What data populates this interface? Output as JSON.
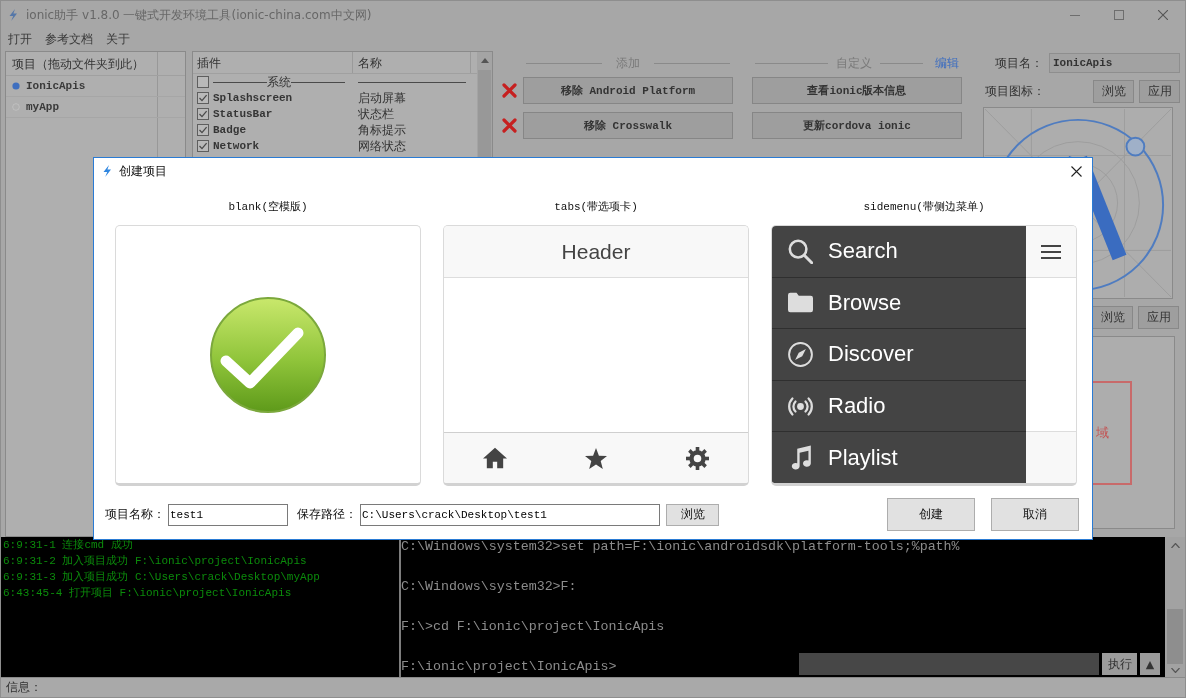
{
  "window": {
    "title": "ionic助手 v1.8.0 一键式开发环境工具(ionic-china.com中文网)"
  },
  "menu": [
    "打开",
    "参考文档",
    "关于"
  ],
  "projects": {
    "header": "项目（拖动文件夹到此）",
    "items": [
      {
        "label": "IonicApis",
        "selected": true
      },
      {
        "label": "myApp",
        "selected": false
      }
    ]
  },
  "plugins": {
    "columns": [
      "插件",
      "名称"
    ],
    "rows": [
      {
        "kind": "group",
        "label": "系统",
        "checked": false
      },
      {
        "kind": "plugin",
        "label": "Splashscreen",
        "name": "启动屏幕",
        "checked": true
      },
      {
        "kind": "plugin",
        "label": "StatusBar",
        "name": "状态栏",
        "checked": true
      },
      {
        "kind": "plugin",
        "label": "Badge",
        "name": "角标提示",
        "checked": true
      },
      {
        "kind": "plugin",
        "label": "Network",
        "name": "网络状态",
        "checked": true
      }
    ]
  },
  "actions": {
    "add_header": "添加",
    "custom_header": "自定义",
    "edit_link": "编辑",
    "remove_buttons": [
      "移除 Android Platform",
      "移除 Crosswalk"
    ],
    "custom_buttons": [
      "查看ionic版本信息",
      "更新cordova ionic"
    ]
  },
  "project_info": {
    "name_label": "项目名：",
    "name_value": "IonicApis",
    "icon_label": "项目图标：",
    "icon_buttons": [
      "浏览",
      "应用"
    ],
    "splash_buttons": [
      "浏览",
      "应用"
    ],
    "splash_area_text": "域"
  },
  "log": [
    "6:9:31-1 连接cmd 成功",
    "6:9:31-2 加入项目成功 F:\\ionic\\project\\IonicApis",
    "6:9:31-3 加入项目成功 C:\\Users\\crack\\Desktop\\myApp",
    "6:43:45-4 打开项目 F:\\ionic\\project\\IonicApis"
  ],
  "console": {
    "lines": [
      "C:\\Windows\\system32>set path=F:\\ionic\\androidsdk\\platform-tools;%path%",
      "C:\\Windows\\system32>F:",
      "F:\\>cd F:\\ionic\\project\\IonicApis",
      "F:\\ionic\\project\\IonicApis>"
    ],
    "run_button": "执行",
    "history_button": "▲"
  },
  "status_bar": {
    "label": "信息："
  },
  "dialog": {
    "title": "创建项目",
    "templates": [
      {
        "kind": "blank",
        "label": "blank(空模版)"
      },
      {
        "kind": "tabs",
        "label": "tabs(带选项卡)",
        "header": "Header"
      },
      {
        "kind": "sidemenu",
        "label": "sidemenu(带侧边菜单)",
        "menu_items": [
          "Search",
          "Browse",
          "Discover",
          "Radio",
          "Playlist"
        ]
      }
    ],
    "name_label": "项目名称：",
    "name_value": "test1",
    "path_label": "保存路径：",
    "path_value": "C:\\Users\\crack\\Desktop\\test1",
    "browse_button": "浏览",
    "create_button": "创建",
    "cancel_button": "取消"
  }
}
